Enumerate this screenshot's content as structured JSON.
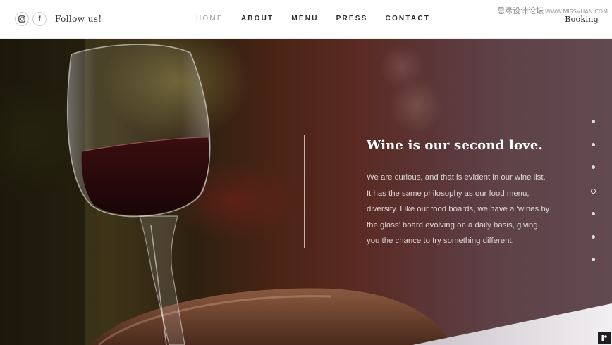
{
  "header": {
    "follow_label": "Follow us!",
    "social_icons": [
      "instagram-icon",
      "facebook-icon"
    ],
    "facebook_glyph": "f",
    "nav": [
      {
        "label": "HOME",
        "active": true
      },
      {
        "label": "ABOUT",
        "active": false
      },
      {
        "label": "MENU",
        "active": false
      },
      {
        "label": "PRESS",
        "active": false
      },
      {
        "label": "CONTACT",
        "active": false
      }
    ],
    "booking_label": "Booking",
    "watermark_cn": "思缘设计论坛",
    "watermark_url": "WWW.MISSVUAN.COM"
  },
  "hero": {
    "title": "Wine is our second love.",
    "body_lines": [
      "We are curious, and that is evident in our wine list.",
      "It has the same philosophy as our food menu,",
      "diversity. Like our food boards, we have a ‘wines by",
      "the glass’ board evolving on a daily basis, giving",
      "you the chance to try something different."
    ],
    "slide_count": 7,
    "active_slide": 4
  },
  "colors": {
    "header_bg": "#ffffff",
    "nav_text": "#2b2b2b",
    "nav_active": "#9a9a9a",
    "hero_text": "#ffffff"
  }
}
